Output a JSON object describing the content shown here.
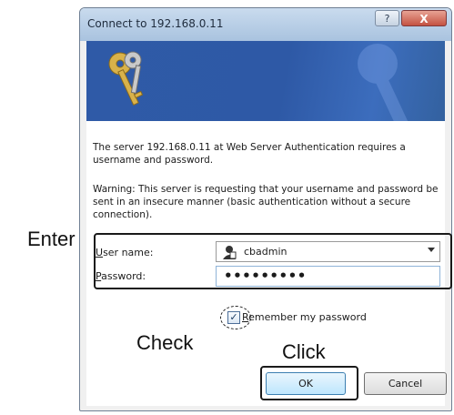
{
  "window": {
    "title": "Connect to 192.168.0.11",
    "help_glyph": "?",
    "close_glyph": "X"
  },
  "banner": {
    "icon": "keys-icon"
  },
  "message": {
    "line1": "The server 192.168.0.11 at Web Server Authentication requires a username and password.",
    "line2": "Warning: This server is requesting that your username and password be sent in an insecure manner (basic authentication without a secure connection)."
  },
  "form": {
    "username_label_underlined": "U",
    "username_label_rest": "ser name:",
    "username_value": "cbadmin",
    "password_label_underlined": "P",
    "password_label_rest": "assword:",
    "password_value": "•••••••••",
    "remember_checked_glyph": "✓",
    "remember_label_underlined": "R",
    "remember_label_rest": "emember my password"
  },
  "buttons": {
    "ok": "OK",
    "cancel": "Cancel"
  },
  "callouts": {
    "enter": "Enter",
    "check": "Check",
    "click": "Click"
  },
  "colors": {
    "banner": "#2f5aa7",
    "titlebar": "#b7cde6",
    "close": "#c45242"
  }
}
